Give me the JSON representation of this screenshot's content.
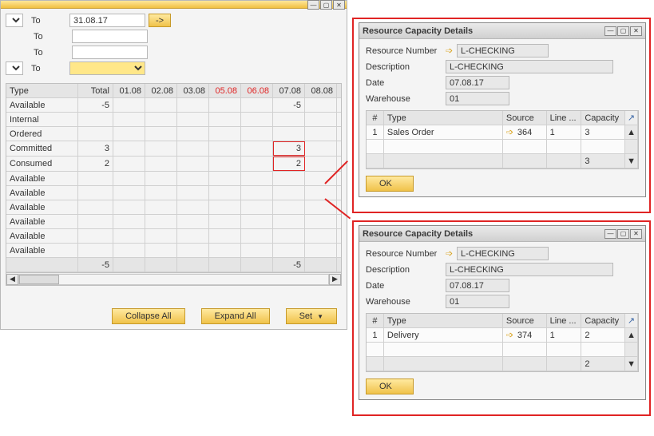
{
  "mainWindow": {
    "toLabel": "To",
    "dateTo": "31.08.17",
    "arrow": "->",
    "headers": [
      "Type",
      "Total",
      "01.08",
      "02.08",
      "03.08",
      "05.08",
      "06.08",
      "07.08",
      "08.08"
    ],
    "redDays": [
      5,
      6
    ],
    "rows": [
      {
        "type": "Available",
        "total": "-5",
        "d7": "-5"
      },
      {
        "type": "Internal"
      },
      {
        "type": "Ordered"
      },
      {
        "type": "Committed",
        "total": "3",
        "d7": "3",
        "hl7": true
      },
      {
        "type": "Consumed",
        "total": "2",
        "d7": "2",
        "hl7": true
      },
      {
        "type": "Available"
      },
      {
        "type": "Available"
      },
      {
        "type": "Available"
      },
      {
        "type": "Available"
      },
      {
        "type": "Available"
      },
      {
        "type": "Available"
      }
    ],
    "footerTotal": "-5",
    "footerD7": "-5",
    "collapseAll": "Collapse All",
    "expandAll": "Expand All",
    "set": "Set"
  },
  "popup1": {
    "title": "Resource Capacity Details",
    "resLabel": "Resource Number",
    "res": "L-CHECKING",
    "descLabel": "Description",
    "desc": "L-CHECKING",
    "dateLabel": "Date",
    "date": "07.08.17",
    "whLabel": "Warehouse",
    "wh": "01",
    "cols": [
      "#",
      "Type",
      "Source",
      "Line ...",
      "Capacity"
    ],
    "r": {
      "n": "1",
      "type": "Sales Order",
      "src": "364",
      "line": "1",
      "cap": "3"
    },
    "footCap": "3",
    "ok": "OK"
  },
  "popup2": {
    "title": "Resource Capacity Details",
    "resLabel": "Resource Number",
    "res": "L-CHECKING",
    "descLabel": "Description",
    "desc": "L-CHECKING",
    "dateLabel": "Date",
    "date": "07.08.17",
    "whLabel": "Warehouse",
    "wh": "01",
    "cols": [
      "#",
      "Type",
      "Source",
      "Line ...",
      "Capacity"
    ],
    "r": {
      "n": "1",
      "type": "Delivery",
      "src": "374",
      "line": "1",
      "cap": "2"
    },
    "footCap": "2",
    "ok": "OK"
  }
}
